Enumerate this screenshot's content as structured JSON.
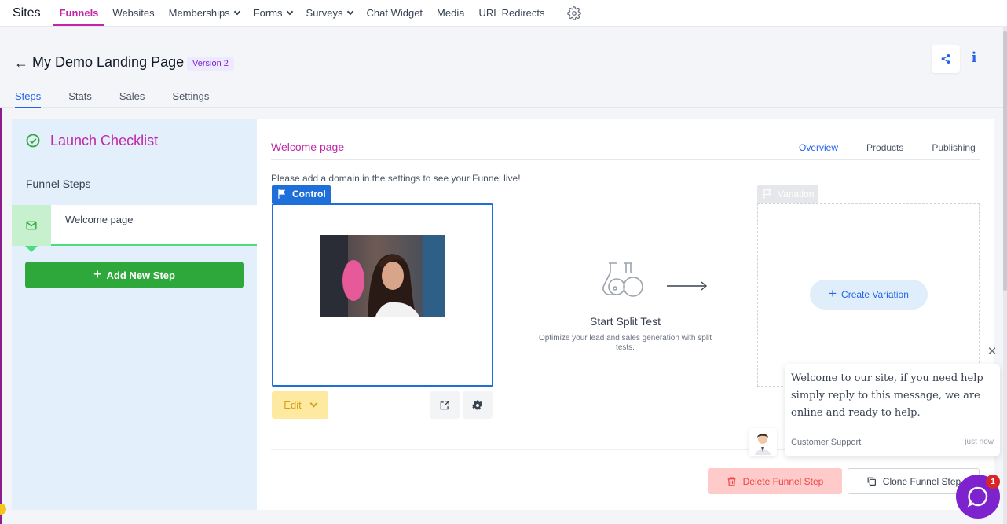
{
  "nav": {
    "brand": "Sites",
    "items": [
      {
        "label": "Funnels",
        "active": true,
        "dropdown": false
      },
      {
        "label": "Websites",
        "active": false,
        "dropdown": false
      },
      {
        "label": "Memberships",
        "active": false,
        "dropdown": true
      },
      {
        "label": "Forms",
        "active": false,
        "dropdown": true
      },
      {
        "label": "Surveys",
        "active": false,
        "dropdown": true
      },
      {
        "label": "Chat Widget",
        "active": false,
        "dropdown": false
      },
      {
        "label": "Media",
        "active": false,
        "dropdown": false
      },
      {
        "label": "URL Redirects",
        "active": false,
        "dropdown": false
      }
    ],
    "settings_icon": "gear-icon"
  },
  "header": {
    "title": "My Demo Landing Page",
    "version": "Version 2",
    "back_icon": "arrow-left-icon",
    "share_icon": "share-icon",
    "info_label": "i",
    "tabs": [
      "Steps",
      "Stats",
      "Sales",
      "Settings"
    ]
  },
  "sidebar": {
    "checklist_title": "Launch Checklist",
    "steps_label": "Funnel Steps",
    "steps": [
      {
        "name": "Welcome page",
        "icon": "mail-icon"
      }
    ],
    "add_step_label": "Add New Step"
  },
  "main": {
    "title": "Welcome page",
    "tabs": [
      "Overview",
      "Products",
      "Publishing"
    ],
    "domain_note": "Please add a domain in the settings to see your Funnel live!",
    "control_label": "Control",
    "edit_label": "Edit",
    "split_title": "Start Split Test",
    "split_desc": "Optimize your lead and sales generation with split tests.",
    "variation_label": "Variation",
    "create_variation_label": "Create Variation",
    "delete_label": "Delete Funnel Step",
    "clone_label": "Clone Funnel Step"
  },
  "chat": {
    "message": "Welcome to our site, if you need help simply reply to this message, we are online and ready to help.",
    "from": "Customer Support",
    "time": "just now",
    "badge": "1",
    "close_label": "✕"
  },
  "colors": {
    "accent": "#c026a8",
    "primary": "#2563eb",
    "success": "#2ea83a",
    "chat": "#7e22ce"
  }
}
